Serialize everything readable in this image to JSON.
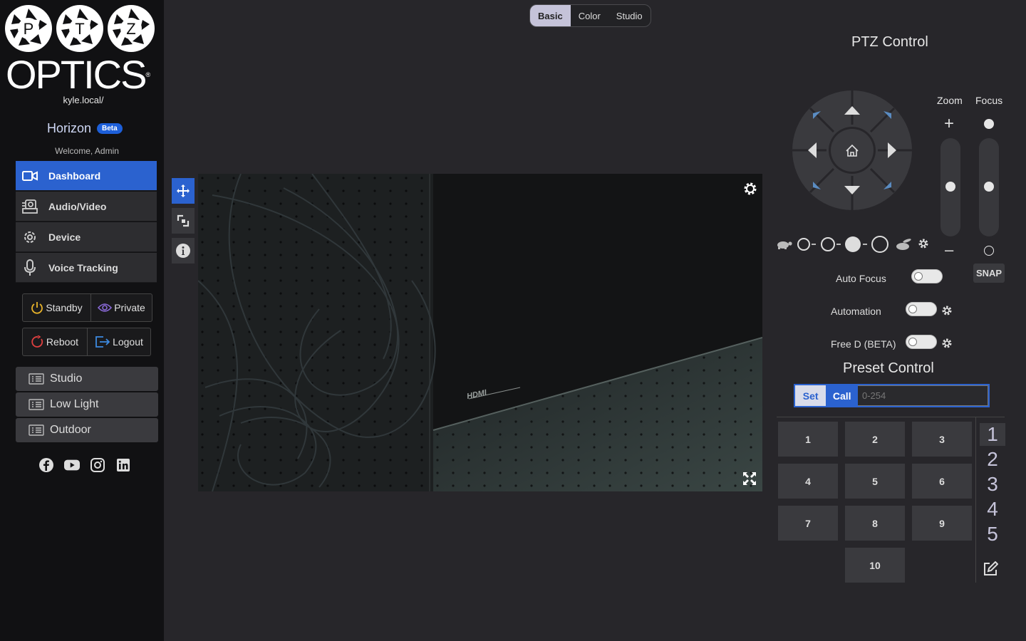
{
  "sidebar": {
    "logo": {
      "letters": [
        "P",
        "T",
        "Z"
      ],
      "wordmark": "OPTICS"
    },
    "hostname": "kyle.local/",
    "product": "Horizon",
    "badge": "Beta",
    "welcome": "Welcome, Admin",
    "nav": [
      {
        "label": "Dashboard",
        "icon": "camera-icon",
        "active": true
      },
      {
        "label": "Audio/Video",
        "icon": "av-icon",
        "active": false
      },
      {
        "label": "Device",
        "icon": "gear-icon",
        "active": false
      },
      {
        "label": "Voice Tracking",
        "icon": "microphone-icon",
        "active": false
      }
    ],
    "power": {
      "standby": "Standby",
      "private": "Private",
      "reboot": "Reboot",
      "logout": "Logout"
    },
    "scenes": [
      "Studio",
      "Low Light",
      "Outdoor"
    ],
    "social": [
      "facebook-icon",
      "youtube-icon",
      "instagram-icon",
      "linkedin-icon"
    ]
  },
  "tabs": [
    {
      "label": "Basic",
      "active": true
    },
    {
      "label": "Color",
      "active": false
    },
    {
      "label": "Studio",
      "active": false
    }
  ],
  "video": {
    "tools": [
      "move-icon",
      "resize-icon",
      "info-icon"
    ],
    "overlay_text": "HDMI"
  },
  "ptz": {
    "title": "PTZ Control",
    "zoom_label": "Zoom",
    "focus_label": "Focus",
    "zoom_plus": "+",
    "zoom_minus": "–",
    "snap_label": "SNAP",
    "speed_level": 3,
    "speed_levels": 4,
    "toggles": [
      {
        "label": "Auto Focus",
        "on": false,
        "has_settings": false
      },
      {
        "label": "Automation",
        "on": false,
        "has_settings": true
      },
      {
        "label": "Free D (BETA)",
        "on": false,
        "has_settings": true
      }
    ]
  },
  "preset": {
    "title": "Preset Control",
    "set_label": "Set",
    "call_label": "Call",
    "input_placeholder": "0-254",
    "buttons": [
      "1",
      "2",
      "3",
      "4",
      "5",
      "6",
      "7",
      "8",
      "9",
      "10"
    ],
    "pages": [
      "1",
      "2",
      "3",
      "4",
      "5"
    ],
    "active_page": "1"
  },
  "colors": {
    "accent": "#2b62cf",
    "sidebar_bg": "#111113",
    "main_bg": "#27262a",
    "tab_active": "#c5c3d9"
  }
}
